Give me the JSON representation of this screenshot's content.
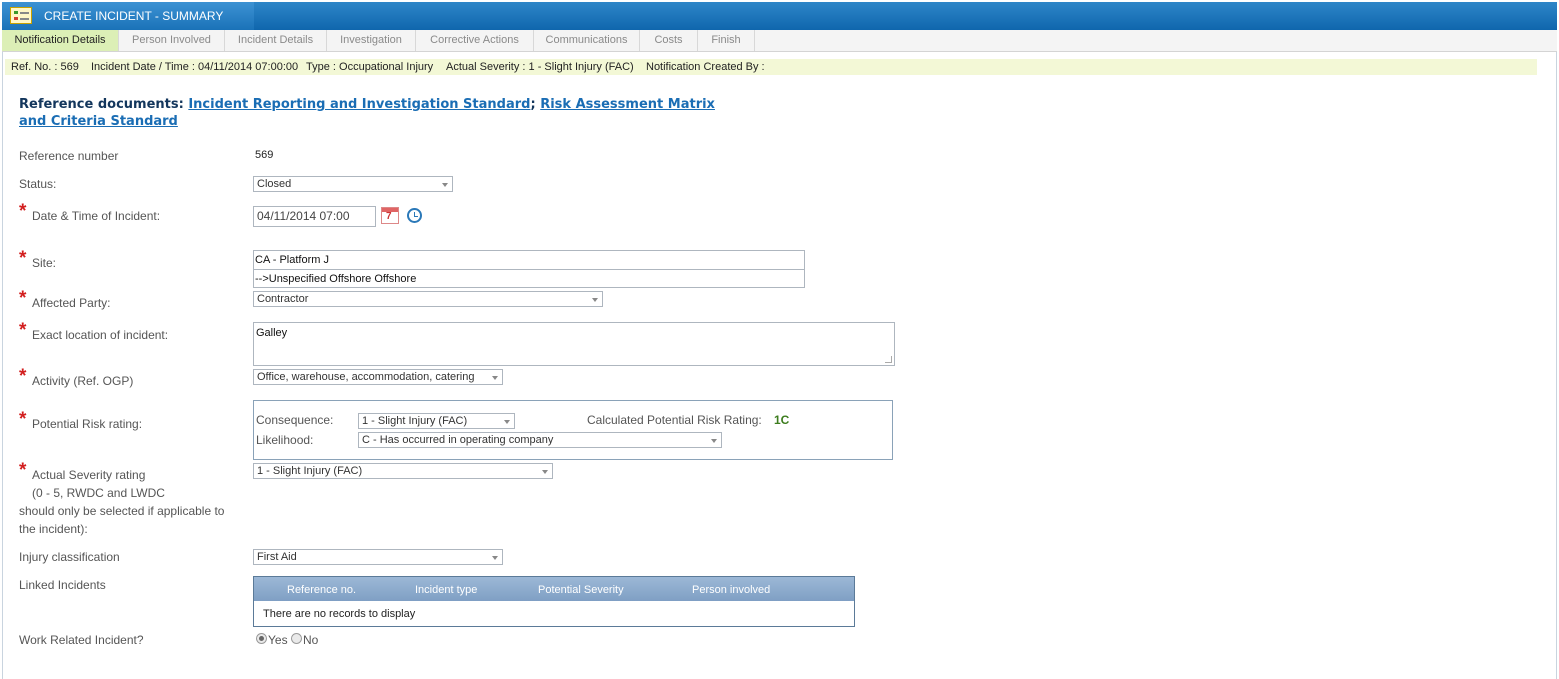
{
  "window": {
    "title": "CREATE INCIDENT - SUMMARY"
  },
  "tabs": [
    {
      "label": "Notification Details",
      "active": true
    },
    {
      "label": "Person Involved"
    },
    {
      "label": "Incident Details"
    },
    {
      "label": "Investigation"
    },
    {
      "label": "Corrective Actions"
    },
    {
      "label": "Communications"
    },
    {
      "label": "Costs"
    },
    {
      "label": "Finish"
    }
  ],
  "infobar": {
    "ref": "Ref. No. : 569",
    "date": "Incident Date / Time : 04/11/2014 07:00:00",
    "type": "Type : Occupational Injury",
    "severity": "Actual Severity : 1 - Slight Injury (FAC)",
    "created_by": "Notification Created By :"
  },
  "refdocs": {
    "prefix": "Reference documents:",
    "link1": "Incident Reporting and Investigation Standard",
    "sep": ";",
    "link2": "Risk Assessment Matrix and Criteria Standard"
  },
  "form": {
    "reference_number": {
      "label": "Reference number",
      "value": "569"
    },
    "status": {
      "label": "Status:",
      "value": "Closed"
    },
    "date_time": {
      "label": "Date & Time of Incident:",
      "value": "04/11/2014 07:00"
    },
    "site": {
      "label": "Site:",
      "line1": "CA - Platform J",
      "line2": "-->Unspecified Offshore Offshore"
    },
    "affected_party": {
      "label": "Affected Party:",
      "value": "Contractor"
    },
    "exact_location": {
      "label": "Exact location of incident:",
      "value": "Galley"
    },
    "activity": {
      "label": "Activity (Ref. OGP)",
      "value": "Office, warehouse, accommodation, catering"
    },
    "potential_risk": {
      "label": "Potential Risk rating:",
      "consequence_label": "Consequence:",
      "consequence_value": "1 - Slight Injury (FAC)",
      "likelihood_label": "Likelihood:",
      "likelihood_value": "C - Has occurred in operating company",
      "calc_label": "Calculated Potential Risk Rating:",
      "calc_value": "1C"
    },
    "actual_severity": {
      "label_line1": "Actual Severity rating",
      "label_line2": "(0 - 5, RWDC and LWDC",
      "label_line3": "should only be selected if applicable to",
      "label_line4": "the incident):",
      "value": "1 - Slight Injury (FAC)"
    },
    "injury_classification": {
      "label": "Injury classification",
      "value": "First Aid"
    },
    "linked_incidents": {
      "label": "Linked Incidents",
      "columns": [
        "Reference no.",
        "Incident type",
        "Potential Severity",
        "Person involved"
      ],
      "empty_text": "There are no records to display"
    },
    "work_related": {
      "label": "Work Related Incident?",
      "yes": "Yes",
      "no": "No",
      "selected": "Yes"
    }
  },
  "icons": {
    "calendar": "calendar-icon",
    "clock": "clock-icon",
    "calendar_day": "7"
  },
  "colors": {
    "titlebar": "#1a72b8",
    "active_tab": "#dcefb6",
    "infobar": "#f3f8d6",
    "required": "#d21e1e",
    "risk_rating": "#3d7d1e",
    "link": "#1a6db4"
  }
}
